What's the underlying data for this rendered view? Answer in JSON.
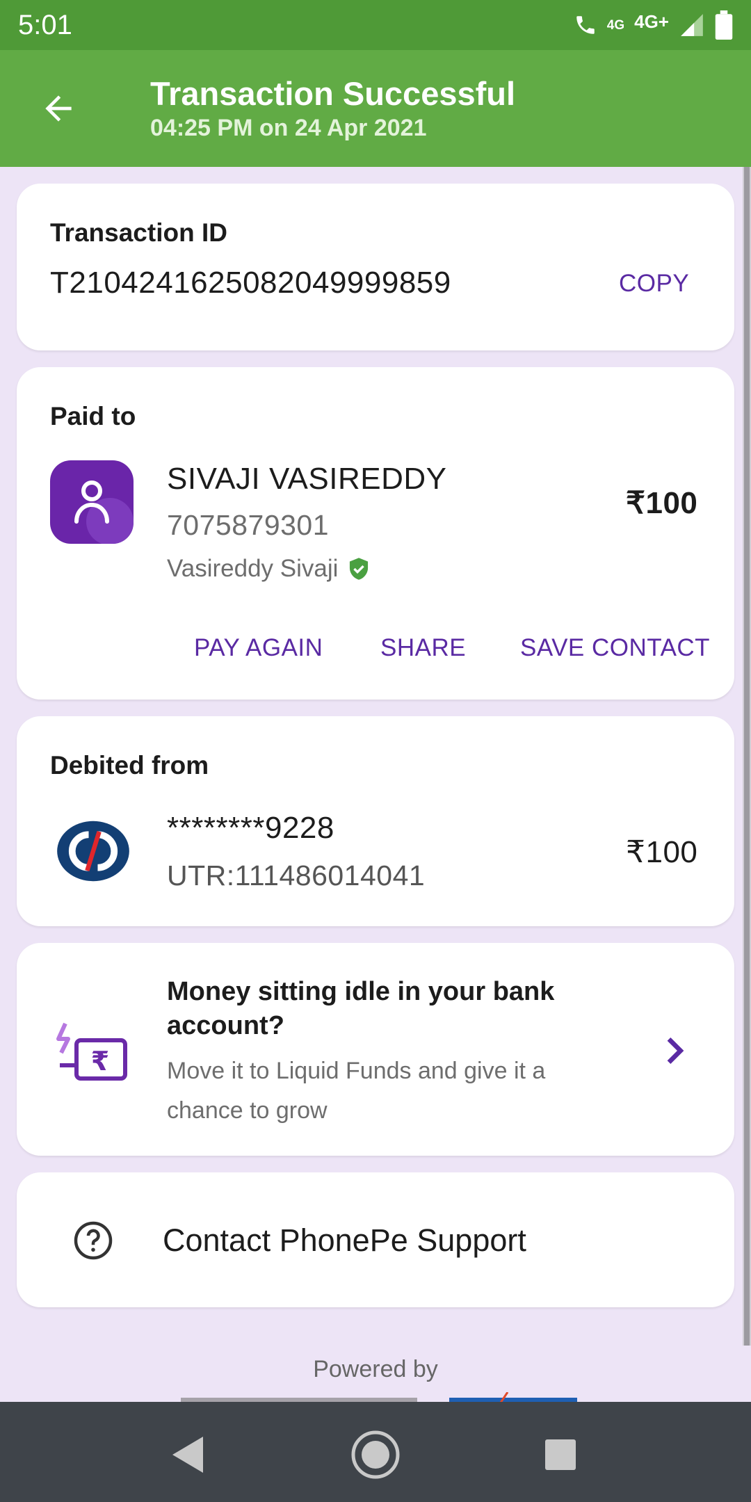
{
  "status_bar": {
    "time": "5:01",
    "volte_label": "4G",
    "network_label": "4G+"
  },
  "header": {
    "title": "Transaction Successful",
    "subtitle": "04:25 PM on 24 Apr 2021",
    "back_icon": "arrow-left-icon"
  },
  "transaction": {
    "label": "Transaction ID",
    "id": "T2104241625082049999859",
    "copy_label": "COPY"
  },
  "paid_to": {
    "label": "Paid to",
    "name": "SIVAJI VASIREDDY",
    "phone": "7075879301",
    "verified_name": "Vasireddy Sivaji",
    "amount": "₹100",
    "actions": {
      "pay_again": "PAY AGAIN",
      "share": "SHARE",
      "save_contact": "SAVE CONTACT"
    }
  },
  "debited_from": {
    "label": "Debited from",
    "account": "********9228",
    "utr": "UTR:111486014041",
    "amount": "₹100"
  },
  "promo": {
    "title": "Money sitting idle in your bank account?",
    "body": "Move it to Liquid Funds and give it a chance to grow"
  },
  "support": {
    "label": "Contact PhonePe Support"
  },
  "footer": {
    "powered_by": "Powered by"
  },
  "colors": {
    "status_bar": "#4f9a37",
    "app_bar": "#61ab45",
    "accent": "#5a2aa3",
    "background": "#ede4f6",
    "nav_bar": "#3f444a"
  }
}
